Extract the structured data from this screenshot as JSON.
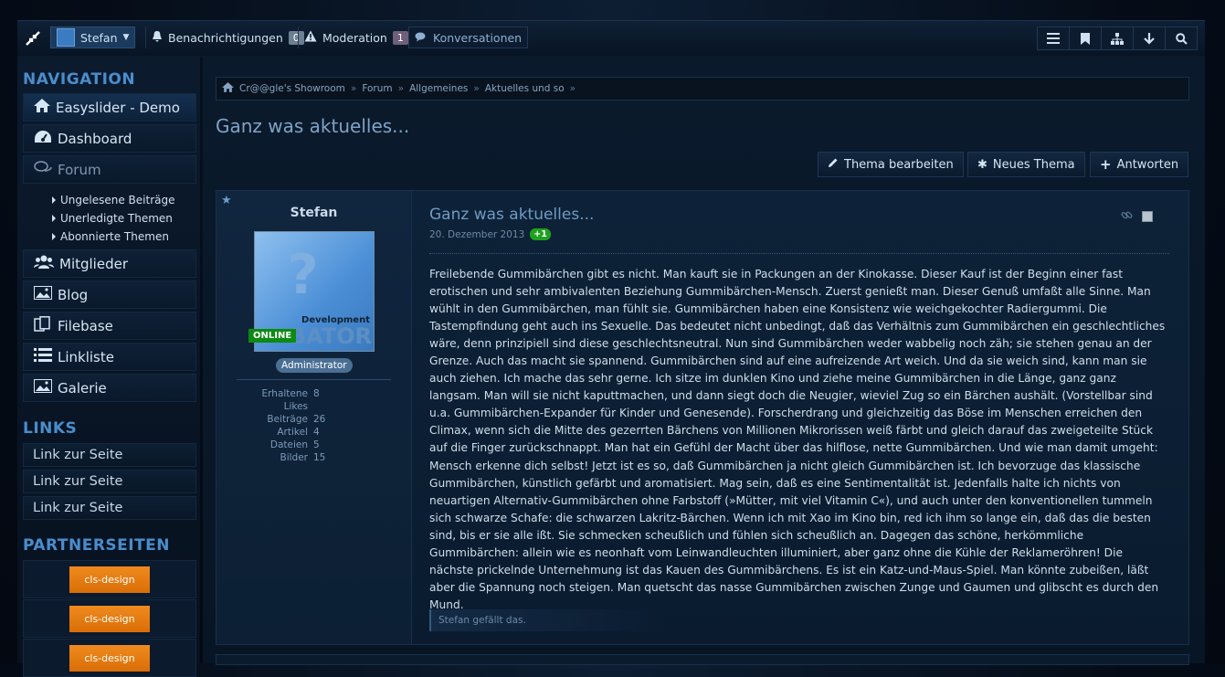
{
  "topbar": {
    "user_name": "Stefan",
    "notifications_label": "Benachrichtigungen",
    "notifications_count": "0",
    "moderation_label": "Moderation",
    "moderation_count": "1",
    "conversations_label": "Konversationen"
  },
  "sidebar": {
    "navigation_heading": "NAVIGATION",
    "nav_items": [
      {
        "label": "Easyslider - Demo",
        "icon": "home-icon"
      },
      {
        "label": "Dashboard",
        "icon": "dashboard-icon"
      },
      {
        "label": "Forum",
        "icon": "comments-icon"
      },
      {
        "label": "Mitglieder",
        "icon": "users-icon"
      },
      {
        "label": "Blog",
        "icon": "picture-icon"
      },
      {
        "label": "Filebase",
        "icon": "files-icon"
      },
      {
        "label": "Linkliste",
        "icon": "list-icon"
      },
      {
        "label": "Galerie",
        "icon": "picture-icon"
      }
    ],
    "forum_sub_items": [
      "Ungelesene Beiträge",
      "Unerledigte Themen",
      "Abonnierte Themen"
    ],
    "links_heading": "LINKS",
    "links": [
      "Link zur Seite",
      "Link zur Seite",
      "Link zur Seite"
    ],
    "partners_heading": "PARTNERSEITEN",
    "partners": [
      "cls-design",
      "cls-design",
      "cls-design"
    ]
  },
  "breadcrumb": [
    "Cr@@gle's Showroom",
    "Forum",
    "Allgemeines",
    "Aktuelles und so"
  ],
  "page_title": "Ganz was aktuelles...",
  "actions": {
    "edit_thread": "Thema bearbeiten",
    "new_thread": "Neues Thema",
    "reply": "Antworten"
  },
  "post": {
    "author": "Stefan",
    "avatar_text_1": "Development",
    "avatar_text_2": "BATOR",
    "online_label": "ONLINE",
    "role": "Administrator",
    "stats": [
      {
        "label": "Erhaltene Likes",
        "value": "8"
      },
      {
        "label": "Beiträge",
        "value": "26"
      },
      {
        "label": "Artikel",
        "value": "4"
      },
      {
        "label": "Dateien",
        "value": "5"
      },
      {
        "label": "Bilder",
        "value": "15"
      }
    ],
    "title": "Ganz was aktuelles...",
    "date": "20. Dezember 2013",
    "rating": "+1",
    "body": "Freilebende Gummibärchen gibt es nicht. Man kauft sie in Packungen an der Kinokasse. Dieser Kauf ist der Beginn einer fast erotischen und sehr ambivalenten Beziehung Gummibärchen-Mensch. Zuerst genießt man. Dieser Genuß umfaßt alle Sinne. Man wühlt in den Gummibärchen, man fühlt sie. Gummibärchen haben eine Konsistenz wie weichgekochter Radiergummi. Die Tastempfindung geht auch ins Sexuelle. Das bedeutet nicht unbedingt, daß das Verhältnis zum Gummibärchen ein geschlechtliches wäre, denn prinzipiell sind diese geschlechtsneutral. Nun sind Gummibärchen weder wabbelig noch zäh; sie stehen genau an der Grenze. Auch das macht sie spannend. Gummibärchen sind auf eine aufreizende Art weich. Und da sie weich sind, kann man sie auch ziehen. Ich mache das sehr gerne. Ich sitze im dunklen Kino und ziehe meine Gummibärchen in die Länge, ganz ganz langsam. Man will sie nicht kaputtmachen, und dann siegt doch die Neugier, wieviel Zug so ein Bärchen aushält. (Vorstellbar sind u.a. Gummibärchen-Expander für Kinder und Genesende). Forscherdrang und gleichzeitig das Böse im Menschen erreichen den Climax, wenn sich die Mitte des gezerrten Bärchens von Millionen Mikrorissen weiß färbt und gleich darauf das zweigeteilte Stück auf die Finger zurückschnappt. Man hat ein Gefühl der Macht über das hilflose, nette Gummibärchen. Und wie man damit umgeht: Mensch erkenne dich selbst! Jetzt ist es so, daß Gummibärchen ja nicht gleich Gummibärchen ist. Ich bevorzuge das klassische Gummibärchen, künstlich gefärbt und aromatisiert. Mag sein, daß es eine Sentimentalität ist. Jedenfalls halte ich nichts von neuartigen Alternativ-Gummibärchen ohne Farbstoff (»Mütter, mit viel Vitamin C«), und auch unter den konventionellen tummeln sich schwarze Schafe: die schwarzen Lakritz-Bärchen. Wenn ich mit Xao im Kino bin, red ich ihm so lange ein, daß das die besten sind, bis er sie alle ißt. Sie schmecken scheußlich und fühlen sich scheußlich an. Dagegen das schöne, herkömmliche Gummibärchen: allein wie es neonhaft vom Leinwandleuchten illuminiert, aber ganz ohne die Kühle der Reklameröhren! Die nächste prickelnde Unternehmung ist das Kauen des Gummibärchens. Es ist ein Katz-und-Maus-Spiel. Man könnte zubeißen, läßt aber die Spannung noch steigen. Man quetscht das nasse Gummibärchen zwischen Zunge und Gaumen und glibscht es durch den Mund.",
    "likes_text": "Stefan gefällt das."
  },
  "colors": {
    "accent": "#4a8dcc",
    "partner_orange": "#e97c12",
    "online_green": "#0d8a12"
  }
}
